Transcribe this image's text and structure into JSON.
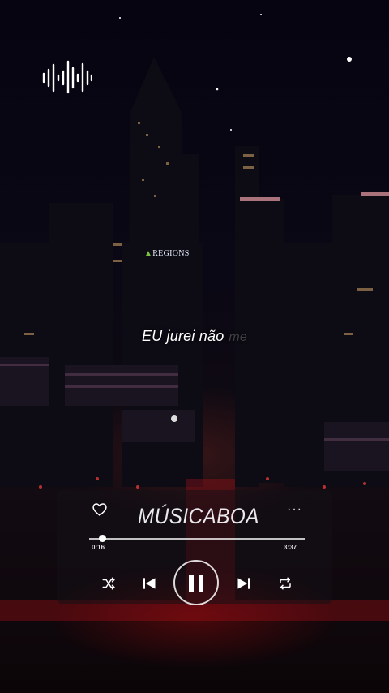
{
  "lyric": {
    "line": "EU jurei não",
    "faded": "me"
  },
  "billboard": "REGIONS",
  "player": {
    "title": "MÚSICABOA",
    "elapsed": "0:16",
    "duration": "3:37",
    "progress": 0.06,
    "more_label": "···"
  },
  "icons": {
    "waveform": "audio-waveform-icon",
    "like": "heart-icon",
    "shuffle": "shuffle-icon",
    "previous": "skip-previous-icon",
    "play_pause": "pause-icon",
    "next": "skip-next-icon",
    "repeat": "repeat-icon",
    "more": "more-options-icon"
  },
  "colors": {
    "text": "#ffffff",
    "glow_red": "#c0141a",
    "sky": "#07060d"
  }
}
